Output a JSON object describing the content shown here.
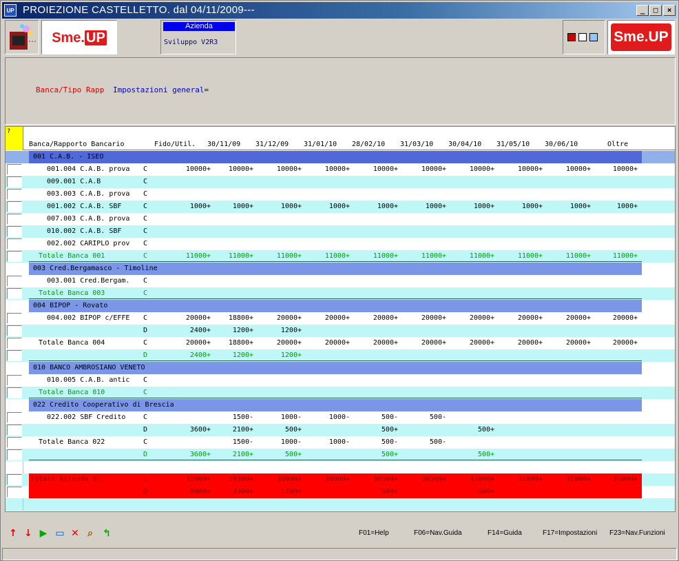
{
  "window": {
    "title": "PROIEZIONE CASTELLETTO.  dal 04/11/2009---",
    "app_icon": "UP"
  },
  "toolbar": {
    "logo_text": "Sme.",
    "logo_up": "UP",
    "azienda_label": "Azienda",
    "azienda_value": "Sviluppo V2R3"
  },
  "params": {
    "label": "Banca/Tipo Rapp",
    "value": "Impostazioni general="
  },
  "grid": {
    "corner": "?",
    "columns": [
      "Banca/Rapporto Bancario",
      "Fido/Util.",
      "30/11/09",
      "31/12/09",
      "31/01/10",
      "28/02/10",
      "31/03/10",
      "30/04/10",
      "31/05/10",
      "30/06/10",
      "Oltre"
    ],
    "rows": [
      {
        "type": "bank",
        "label": "001 C.A.B. - ISEO",
        "first": true
      },
      {
        "type": "data",
        "bg": "white",
        "desc": "  001.004 C.A.B. prova",
        "fu": "C",
        "v": [
          "10000+",
          "10000+",
          "10000+",
          "10000+",
          "10000+",
          "10000+",
          "10000+",
          "10000+",
          "10000+",
          "10000+"
        ]
      },
      {
        "type": "data",
        "bg": "cyan",
        "desc": "  009.001 C.A.B",
        "fu": "C",
        "v": [
          "",
          "",
          "",
          "",
          "",
          "",
          "",
          "",
          "",
          ""
        ]
      },
      {
        "type": "data",
        "bg": "white",
        "desc": "  003.003 C.A.B. prova",
        "fu": "C",
        "v": [
          "",
          "",
          "",
          "",
          "",
          "",
          "",
          "",
          "",
          ""
        ]
      },
      {
        "type": "data",
        "bg": "cyan",
        "desc": "  001.002 C.A.B. SBF",
        "fu": "C",
        "v": [
          "1000+",
          "1000+",
          "1000+",
          "1000+",
          "1000+",
          "1000+",
          "1000+",
          "1000+",
          "1000+",
          "1000+"
        ]
      },
      {
        "type": "data",
        "bg": "white",
        "desc": "  007.003 C.A.B. prova",
        "fu": "C",
        "v": [
          "",
          "",
          "",
          "",
          "",
          "",
          "",
          "",
          "",
          ""
        ]
      },
      {
        "type": "data",
        "bg": "cyan",
        "desc": "  010.002 C.A.B. SBF",
        "fu": "C",
        "v": [
          "",
          "",
          "",
          "",
          "",
          "",
          "",
          "",
          "",
          ""
        ]
      },
      {
        "type": "data",
        "bg": "white",
        "desc": "  002.002 CARIPLO prov",
        "fu": "C",
        "v": [
          "",
          "",
          "",
          "",
          "",
          "",
          "",
          "",
          "",
          ""
        ]
      },
      {
        "type": "total",
        "bg": "cyan",
        "desc": "Totale Banca 001",
        "fu": "C",
        "v": [
          "11000+",
          "11000+",
          "11000+",
          "11000+",
          "11000+",
          "11000+",
          "11000+",
          "11000+",
          "11000+",
          "11000+"
        ]
      },
      {
        "type": "bank",
        "label": "003 Cred.Bergamasco - Timoline"
      },
      {
        "type": "data",
        "bg": "white",
        "desc": "  003.001 Cred.Bergam.",
        "fu": "C",
        "v": [
          "",
          "",
          "",
          "",
          "",
          "",
          "",
          "",
          "",
          ""
        ]
      },
      {
        "type": "total",
        "bg": "cyan",
        "desc": "Totale Banca 003",
        "fu": "C",
        "v": [
          "",
          "",
          "",
          "",
          "",
          "",
          "",
          "",
          "",
          ""
        ]
      },
      {
        "type": "bank",
        "label": "004 BIPOP - Rovato"
      },
      {
        "type": "data",
        "bg": "white",
        "desc": "  004.002 BIPOP c/EFFE",
        "fu": "C",
        "v": [
          "20000+",
          "18800+",
          "20000+",
          "20000+",
          "20000+",
          "20000+",
          "20000+",
          "20000+",
          "20000+",
          "20000+"
        ]
      },
      {
        "type": "data",
        "bg": "cyan",
        "desc": "",
        "fu": "D",
        "v": [
          "2400+",
          "1200+",
          "1200+",
          "",
          "",
          "",
          "",
          "",
          "",
          ""
        ]
      },
      {
        "type": "data",
        "bg": "white",
        "desc": "Totale Banca 004",
        "fu": "C",
        "v": [
          "20000+",
          "18800+",
          "20000+",
          "20000+",
          "20000+",
          "20000+",
          "20000+",
          "20000+",
          "20000+",
          "20000+"
        ]
      },
      {
        "type": "total",
        "bg": "cyan",
        "desc": "",
        "fu": "D",
        "v": [
          "2400+",
          "1200+",
          "1200+",
          "",
          "",
          "",
          "",
          "",
          "",
          ""
        ]
      },
      {
        "type": "bank",
        "label": "010 BANCO AMBROSIANO VENETO"
      },
      {
        "type": "data",
        "bg": "white",
        "desc": "  010.005 C.A.B. antic",
        "fu": "C",
        "v": [
          "",
          "",
          "",
          "",
          "",
          "",
          "",
          "",
          "",
          ""
        ]
      },
      {
        "type": "total",
        "bg": "cyan",
        "desc": "Totale Banca 010",
        "fu": "C",
        "v": [
          "",
          "",
          "",
          "",
          "",
          "",
          "",
          "",
          "",
          ""
        ]
      },
      {
        "type": "bank",
        "label": "022 Credito Cooperativo di Brescia"
      },
      {
        "type": "data",
        "bg": "white",
        "desc": "  022.002 SBF Credito",
        "fu": "C",
        "v": [
          "",
          "1500-",
          "1000-",
          "1000-",
          "500-",
          "500-",
          "",
          "",
          "",
          ""
        ]
      },
      {
        "type": "data",
        "bg": "cyan",
        "desc": "",
        "fu": "D",
        "v": [
          "3600+",
          "2100+",
          "500+",
          "",
          "500+",
          "",
          "500+",
          "",
          "",
          ""
        ]
      },
      {
        "type": "data",
        "bg": "white",
        "desc": "Totale Banca 022",
        "fu": "C",
        "v": [
          "",
          "1500-",
          "1000-",
          "1000-",
          "500-",
          "500-",
          "",
          "",
          "",
          ""
        ]
      },
      {
        "type": "total",
        "bg": "cyan",
        "desc": "",
        "fu": "D",
        "v": [
          "3600+",
          "2100+",
          "500+",
          "",
          "500+",
          "",
          "500+",
          "",
          "",
          ""
        ]
      },
      {
        "type": "empty",
        "bg": "white"
      },
      {
        "type": "red",
        "bg": "cyan",
        "desc": "Totale Azienda 01",
        "fu": "C",
        "v": [
          "31000+",
          "20300+",
          "30000+",
          "30000+",
          "30500+",
          "30500+",
          "31000+",
          "31000+",
          "31000+",
          "31000+"
        ]
      },
      {
        "type": "red",
        "bg": "white",
        "desc": "",
        "fu": "D",
        "v": [
          "6000+",
          "3300+",
          "1700+",
          "",
          "500+",
          "",
          "500+",
          "",
          "",
          ""
        ]
      },
      {
        "type": "empty",
        "bg": "cyan"
      }
    ]
  },
  "bottom": {
    "icons": [
      "arrow-up-icon",
      "arrow-down-icon",
      "play-icon",
      "window-icon",
      "close-x-icon",
      "magnifier-icon",
      "arrow-return-icon"
    ],
    "fkeys": [
      "F01=Help",
      "F06=Nav.Guida",
      "F14=Guida",
      "F17=Impostazioni",
      "F23=Nav.Funzioni"
    ]
  }
}
